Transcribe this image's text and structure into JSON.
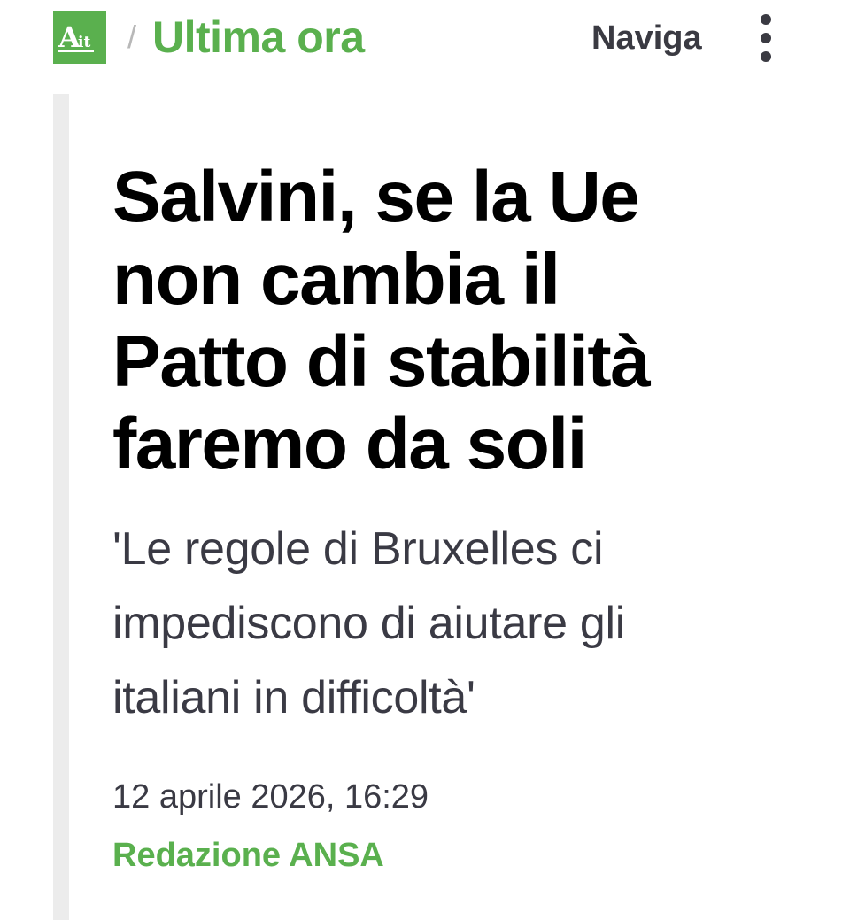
{
  "header": {
    "logo_text": "Ait",
    "breadcrumb_separator": "/",
    "section_title": "Ultima ora",
    "nav_label": "Naviga",
    "menu_icon": "kebab-menu-icon"
  },
  "article": {
    "headline": "Salvini, se la Ue non cambia il Patto di stabilità faremo da soli",
    "subtitle": "'Le regole di Bruxelles ci impediscono di aiutare gli italiani in difficoltà'",
    "date": "12 aprile 2026, 16:29",
    "author": "Redazione ANSA"
  },
  "colors": {
    "brand_green": "#5ab04e",
    "text_dark": "#000000",
    "text_muted": "#3a3a44",
    "rule_gray": "#ececec"
  }
}
